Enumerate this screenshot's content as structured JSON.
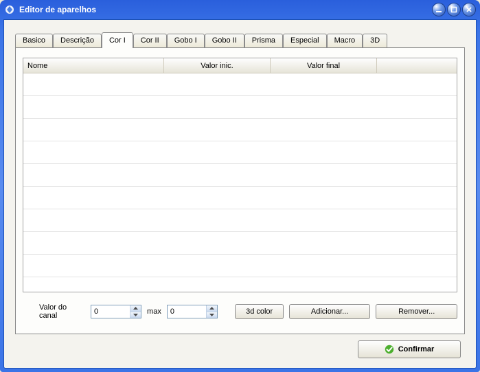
{
  "window": {
    "title": "Editor de aparelhos"
  },
  "tabs": [
    {
      "label": "Basico"
    },
    {
      "label": "Descrição"
    },
    {
      "label": "Cor I"
    },
    {
      "label": "Cor II"
    },
    {
      "label": "Gobo I"
    },
    {
      "label": "Gobo II"
    },
    {
      "label": "Prisma"
    },
    {
      "label": "Especial"
    },
    {
      "label": "Macro"
    },
    {
      "label": "3D"
    }
  ],
  "active_tab_index": 2,
  "table": {
    "headers": {
      "name": "Nome",
      "init": "Valor inic.",
      "final": "Valor final",
      "extra": ""
    }
  },
  "controls": {
    "channel_label": "Valor do canal",
    "channel_value": "0",
    "max_label": "max",
    "max_value": "0",
    "color3d_label": "3d color",
    "add_label": "Adicionar...",
    "remove_label": "Remover..."
  },
  "footer": {
    "confirm_label": "Confirmar"
  }
}
